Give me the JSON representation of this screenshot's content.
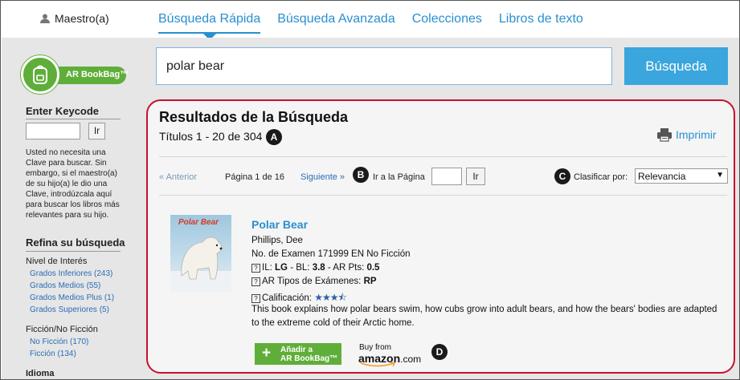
{
  "header": {
    "user_label": "Maestro(a)",
    "tabs": [
      {
        "label": "Búsqueda Rápida",
        "active": true
      },
      {
        "label": "Búsqueda Avanzada",
        "active": false
      },
      {
        "label": "Colecciones",
        "active": false
      },
      {
        "label": "Libros de texto",
        "active": false
      }
    ]
  },
  "sidebar": {
    "logo_text": "AR BookBag™",
    "keycode_heading": "Enter Keycode",
    "keycode_button": "Ir",
    "keycode_note": "Usted no necesita una Clave para buscar. Sin embargo, si el maestro(a) de su hijo(a) le dio una Clave, introdúzcala aquí para buscar los libros más relevantes para su hijo.",
    "refine_heading": "Refina su búsqueda",
    "interest_label": "Nivel de Interés",
    "interest_items": [
      "Grados Inferiores (243)",
      "Grados Medios (55)",
      "Grados Medios Plus (1)",
      "Grados Superiores (5)"
    ],
    "fiction_label": "Ficción/No Ficción",
    "fiction_items": [
      "No Ficción (170)",
      "Ficción (134)"
    ],
    "language_label": "Idioma"
  },
  "search": {
    "query": "polar bear",
    "button_label": "Búsqueda"
  },
  "results": {
    "title": "Resultados de la Búsqueda",
    "count_text": "Títulos 1 - 20 de 304",
    "print_label": "Imprimir",
    "prev_label": "« Anterior",
    "page_info": "Página 1 de 16",
    "next_label": "Siguiente »",
    "goto_label": "Ir a la Página",
    "goto_button": "Ir",
    "sort_label": "Clasificar por:",
    "sort_value": "Relevancia",
    "badges": {
      "a": "A",
      "b": "B",
      "c": "C",
      "d": "D"
    }
  },
  "book": {
    "cover_title": "Polar Bear",
    "title": "Polar Bear",
    "author": "Phillips, Dee",
    "quiz_line": "No. de Examen 171999 EN No Ficción",
    "il_label": "IL:",
    "il_value": "LG",
    "bl_label": "- BL:",
    "bl_value": "3.8",
    "pts_label": "- AR Pts:",
    "pts_value": "0.5",
    "quiz_types_label": "AR Tipos de Exámenes:",
    "quiz_types_value": "RP",
    "rating_label": "Calificación:",
    "rating_stars": "★★★⯪",
    "help_glyph": "?",
    "description": "This book explains how polar bears swim, how cubs grow into adult bears, and how the bears' bodies are adapted to the extreme cold of their Arctic home.",
    "add_button_line1": "Añadir a",
    "add_button_line2": "AR BookBag™",
    "add_plus": "+",
    "amazon_buy": "Buy from",
    "amazon_brand": "amazon",
    "amazon_tld": ".com"
  },
  "colors": {
    "accent": "#2a8fcf",
    "search_button": "#3aa6dd",
    "panel_border": "#c8102e",
    "green": "#5fae3a",
    "sidebar_bg": "#e6e6e6"
  }
}
